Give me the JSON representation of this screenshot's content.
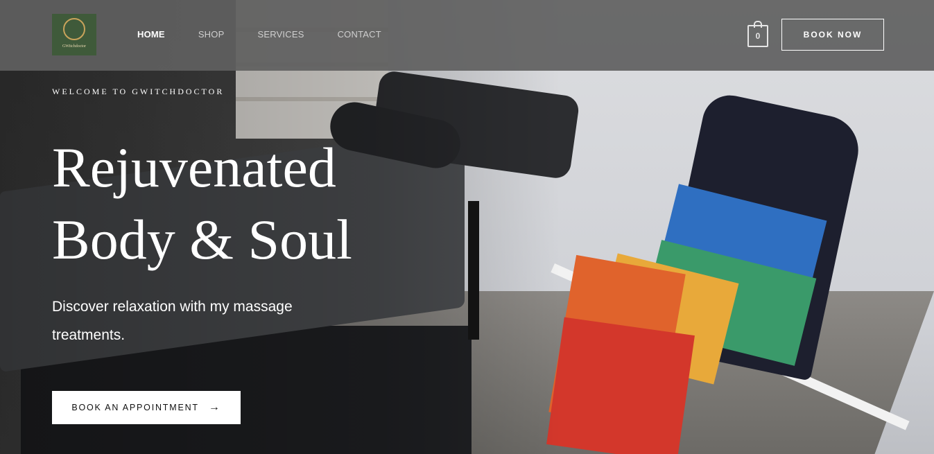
{
  "header": {
    "logo_text": "GWitchdoctor",
    "nav": [
      {
        "label": "HOME",
        "active": true
      },
      {
        "label": "SHOP"
      },
      {
        "label": "SERVICES"
      },
      {
        "label": "CONTACT"
      }
    ],
    "cart_count": "0",
    "book_now_label": "BOOK NOW"
  },
  "hero": {
    "eyebrow": "WELCOME TO GWITCHDOCTOR",
    "headline_line1": "Rejuvenated",
    "headline_line2": "Body & Soul",
    "subtext": "Discover relaxation with my massage treatments.",
    "cta_label": "BOOK AN APPOINTMENT",
    "cta_icon": "arrow-right-icon"
  },
  "colors": {
    "header_bg": "#5f5f5f",
    "logo_bg": "#3f5a3a",
    "text_primary": "#ffffff"
  }
}
